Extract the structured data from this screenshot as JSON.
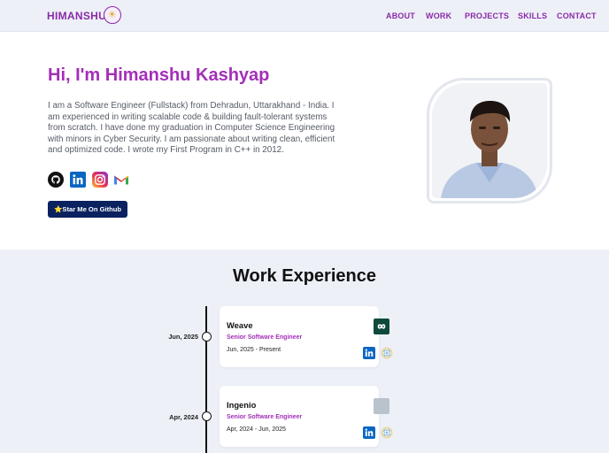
{
  "nav": {
    "brand": "HIMANSHU",
    "links": [
      "ABOUT",
      "WORK",
      "PROJECTS",
      "SKILLS",
      "CONTACT"
    ]
  },
  "hero": {
    "title": "Hi, I'm Himanshu Kashyap",
    "description": "I am a Software Engineer (Fullstack) from Dehradun, Uttarakhand - India. I am experienced in writing scalable code & building fault-tolerant systems from scratch. I have done my graduation in Computer Science Engineering with minors in Cyber Security. I am passionate about writing clean, efficient and optimized code. I wrote my First Program in C++ in 2012.",
    "social_icons": [
      "github-icon",
      "linkedin-icon",
      "instagram-icon",
      "gmail-icon"
    ],
    "star_button": "⭐Star Me On Github"
  },
  "work": {
    "title": "Work Experience",
    "entries": [
      {
        "date": "Jun, 2025",
        "company": "Weave",
        "role": "Senior Software Engineer",
        "period": "Jun, 2025 - Present",
        "logo_color": "#0d4a3c"
      },
      {
        "date": "Apr, 2024",
        "company": "Ingenio",
        "role": "Senior Software Engineer",
        "period": "Apr, 2024 - Jun, 2025",
        "logo_color": "#b9c3cc"
      }
    ]
  },
  "colors": {
    "accent": "#a32fb8",
    "nav_bg": "#edf0f7",
    "button_bg": "#0b2260"
  }
}
